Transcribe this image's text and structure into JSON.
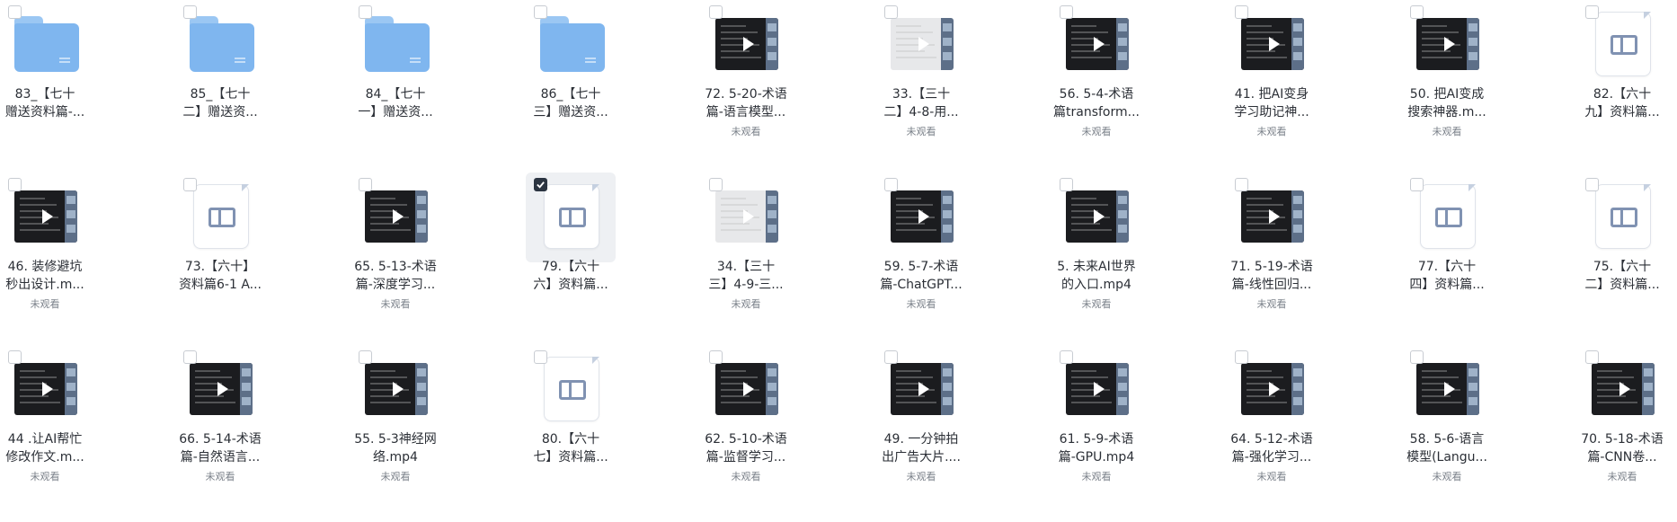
{
  "status_label": "未观看",
  "colors": {
    "folder": "#7fb6ef",
    "video_dark": "#1b1c1f",
    "doc_icon": "#8092b2",
    "text": "#2b2f36",
    "muted": "#7a8089",
    "selected_bg": "#eef0f3"
  },
  "items": [
    {
      "kind": "folder",
      "name": "83_【七十\n赠送资料篇-...",
      "status": "",
      "selected": false
    },
    {
      "kind": "folder",
      "name": "85_【七十\n二】赠送资...",
      "status": "",
      "selected": false
    },
    {
      "kind": "folder",
      "name": "84_【七十\n一】赠送资...",
      "status": "",
      "selected": false
    },
    {
      "kind": "folder",
      "name": "86_【七十\n三】赠送资...",
      "status": "",
      "selected": false
    },
    {
      "kind": "video",
      "style": "dark",
      "name": "72. 5-20-术语\n篇-语言模型...",
      "status": "未观看",
      "selected": false
    },
    {
      "kind": "video",
      "style": "light",
      "name": "33.【三十\n二】4-8-用...",
      "status": "未观看",
      "selected": false
    },
    {
      "kind": "video",
      "style": "dark",
      "name": "56. 5-4-术语\n篇transform...",
      "status": "未观看",
      "selected": false
    },
    {
      "kind": "video",
      "style": "dark",
      "name": "41. 把AI变身\n学习助记神...",
      "status": "未观看",
      "selected": false
    },
    {
      "kind": "video",
      "style": "dark",
      "name": "50. 把AI变成\n搜索神器.m...",
      "status": "未观看",
      "selected": false
    },
    {
      "kind": "doc",
      "name": "82.【六十\n九】资料篇...",
      "status": "",
      "selected": false
    },
    {
      "kind": "video",
      "style": "dark",
      "name": "46. 装修避坑\n秒出设计.m...",
      "status": "未观看",
      "selected": false
    },
    {
      "kind": "doc",
      "name": "73.【六十】\n资料篇6-1 A...",
      "status": "",
      "selected": false
    },
    {
      "kind": "video",
      "style": "dark",
      "name": "65. 5-13-术语\n篇-深度学习...",
      "status": "未观看",
      "selected": false
    },
    {
      "kind": "doc",
      "name": "79.【六十\n六】资料篇...",
      "status": "",
      "selected": true
    },
    {
      "kind": "video",
      "style": "light",
      "name": "34.【三十\n三】4-9-三...",
      "status": "未观看",
      "selected": false
    },
    {
      "kind": "video",
      "style": "dark",
      "name": "59. 5-7-术语\n篇-ChatGPT...",
      "status": "未观看",
      "selected": false
    },
    {
      "kind": "video",
      "style": "dark",
      "name": "5. 未来AI世界\n的入口.mp4",
      "status": "未观看",
      "selected": false
    },
    {
      "kind": "video",
      "style": "dark",
      "name": "71. 5-19-术语\n篇-线性回归...",
      "status": "未观看",
      "selected": false
    },
    {
      "kind": "doc",
      "name": "77.【六十\n四】资料篇...",
      "status": "",
      "selected": false
    },
    {
      "kind": "doc",
      "name": "75.【六十\n二】资料篇...",
      "status": "",
      "selected": false
    },
    {
      "kind": "video",
      "style": "dark",
      "name": "44 .让AI帮忙\n修改作文.m...",
      "status": "未观看",
      "selected": false
    },
    {
      "kind": "video",
      "style": "dark",
      "name": "66. 5-14-术语\n篇-自然语言...",
      "status": "未观看",
      "selected": false
    },
    {
      "kind": "video",
      "style": "dark",
      "name": "55. 5-3神经网\n络.mp4",
      "status": "未观看",
      "selected": false
    },
    {
      "kind": "doc",
      "name": "80.【六十\n七】资料篇...",
      "status": "",
      "selected": false
    },
    {
      "kind": "video",
      "style": "dark",
      "name": "62. 5-10-术语\n篇-监督学习...",
      "status": "未观看",
      "selected": false
    },
    {
      "kind": "video",
      "style": "dark",
      "name": "49. 一分钟拍\n出广告大片....",
      "status": "未观看",
      "selected": false
    },
    {
      "kind": "video",
      "style": "dark",
      "name": "61. 5-9-术语\n篇-GPU.mp4",
      "status": "未观看",
      "selected": false
    },
    {
      "kind": "video",
      "style": "dark",
      "name": "64. 5-12-术语\n篇-强化学习...",
      "status": "未观看",
      "selected": false
    },
    {
      "kind": "video",
      "style": "dark",
      "name": "58. 5-6-语言\n模型(Langu...",
      "status": "未观看",
      "selected": false
    },
    {
      "kind": "video",
      "style": "dark",
      "name": "70. 5-18-术语\n篇-CNN卷...",
      "status": "未观看",
      "selected": false
    }
  ]
}
